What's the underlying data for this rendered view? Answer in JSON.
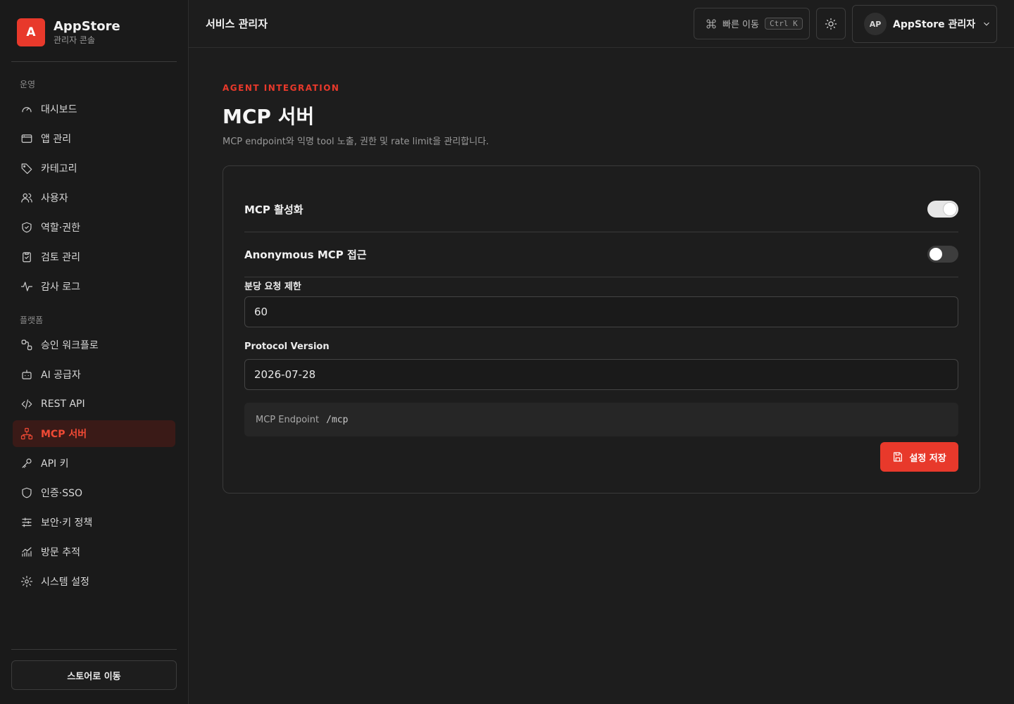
{
  "brand": {
    "logo_letter": "A",
    "title": "AppStore",
    "subtitle": "관리자 콘솔"
  },
  "sidebar": {
    "sections": [
      {
        "label": "운영"
      },
      {
        "label": "플랫폼"
      }
    ],
    "items": [
      {
        "label": "대시보드",
        "icon": "gauge-icon"
      },
      {
        "label": "앱 관리",
        "icon": "window-icon"
      },
      {
        "label": "카테고리",
        "icon": "tag-icon"
      },
      {
        "label": "사용자",
        "icon": "users-icon"
      },
      {
        "label": "역할·권한",
        "icon": "shield-check-icon"
      },
      {
        "label": "검토 관리",
        "icon": "clipboard-check-icon"
      },
      {
        "label": "감사 로그",
        "icon": "activity-icon"
      },
      {
        "label": "승인 워크플로",
        "icon": "workflow-icon"
      },
      {
        "label": "AI 공급자",
        "icon": "bot-icon"
      },
      {
        "label": "REST API",
        "icon": "code-icon"
      },
      {
        "label": "MCP 서버",
        "icon": "network-icon",
        "active": true
      },
      {
        "label": "API 키",
        "icon": "key-icon"
      },
      {
        "label": "인증·SSO",
        "icon": "shield-icon"
      },
      {
        "label": "보안·키 정책",
        "icon": "sliders-icon"
      },
      {
        "label": "방문 추적",
        "icon": "chart-icon"
      },
      {
        "label": "시스템 설정",
        "icon": "gear-icon"
      }
    ],
    "store_button": "스토어로 이동"
  },
  "header": {
    "title": "서비스 관리자",
    "quick_nav_label": "빠른 이동",
    "quick_nav_shortcut": "Ctrl K",
    "user_initials": "AP",
    "user_name": "AppStore 관리자"
  },
  "main": {
    "eyebrow": "AGENT INTEGRATION",
    "title": "MCP 서버",
    "description": "MCP endpoint와 익명 tool 노출, 권한 및 rate limit을 관리합니다.",
    "settings": {
      "mcp_enabled_label": "MCP 활성화",
      "mcp_enabled": true,
      "anonymous_label": "Anonymous MCP 접근",
      "anonymous_enabled": false,
      "rate_limit_label": "분당 요청 제한",
      "rate_limit_value": "60",
      "protocol_label": "Protocol Version",
      "protocol_value": "2026-07-28",
      "endpoint_label": "MCP Endpoint",
      "endpoint_path": "/mcp",
      "save_label": "설정 저장"
    }
  },
  "colors": {
    "accent": "#e8392b",
    "background": "#1d1d1d",
    "sidebar": "#1a1a1a"
  }
}
